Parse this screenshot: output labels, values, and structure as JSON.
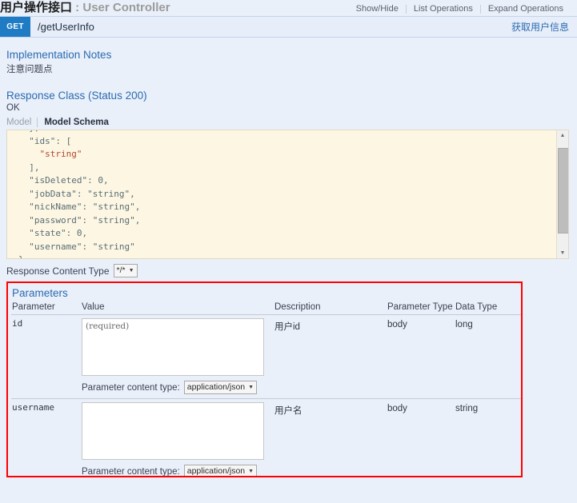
{
  "resource": {
    "title_cn": "用户操作接口",
    "title_sep": " : ",
    "title_en": "User Controller",
    "options": [
      {
        "label": "Show/Hide"
      },
      {
        "label": "List Operations"
      },
      {
        "label": "Expand Operations"
      }
    ]
  },
  "operation": {
    "method": "GET",
    "path": "/getUserInfo",
    "summary": "获取用户信息",
    "method_color": "#1f7cc4"
  },
  "notes": {
    "heading": "Implementation Notes",
    "text": "注意问题点"
  },
  "response_class": {
    "heading": "Response Class (Status 200)",
    "status_text": "OK",
    "tabs": [
      {
        "label": "Model",
        "active": false
      },
      {
        "label": "Model Schema",
        "active": true
      }
    ],
    "schema_lines": [
      {
        "indent": 2,
        "text": "},",
        "type": "punct"
      },
      {
        "indent": 2,
        "text": "\"ids\": [",
        "type": "keyopen"
      },
      {
        "indent": 4,
        "text": "\"string\"",
        "type": "string"
      },
      {
        "indent": 2,
        "text": "],",
        "type": "punct"
      },
      {
        "indent": 2,
        "text": "\"isDeleted\": 0,",
        "type": "keynum"
      },
      {
        "indent": 2,
        "text": "\"jobData\": \"string\",",
        "type": "keystr"
      },
      {
        "indent": 2,
        "text": "\"nickName\": \"string\",",
        "type": "keystr"
      },
      {
        "indent": 2,
        "text": "\"password\": \"string\",",
        "type": "keystr"
      },
      {
        "indent": 2,
        "text": "\"state\": 0,",
        "type": "keynum"
      },
      {
        "indent": 2,
        "text": "\"username\": \"string\"",
        "type": "keystr"
      },
      {
        "indent": 0,
        "text": "}",
        "type": "punct"
      }
    ]
  },
  "response_content_type": {
    "label": "Response Content Type",
    "value": "*/*"
  },
  "parameters": {
    "heading": "Parameters",
    "columns": [
      "Parameter",
      "Value",
      "Description",
      "Parameter Type",
      "Data Type"
    ],
    "rows": [
      {
        "name": "id",
        "value": "",
        "placeholder": "(required)",
        "description": "用户id",
        "parameter_type": "body",
        "data_type": "long",
        "content_type_label": "Parameter content type:",
        "content_type_value": "application/json"
      },
      {
        "name": "username",
        "value": "",
        "placeholder": "",
        "description": "用户名",
        "parameter_type": "body",
        "data_type": "string",
        "content_type_label": "Parameter content type:",
        "content_type_value": "application/json"
      }
    ],
    "highlight_color": "#ff0000"
  }
}
